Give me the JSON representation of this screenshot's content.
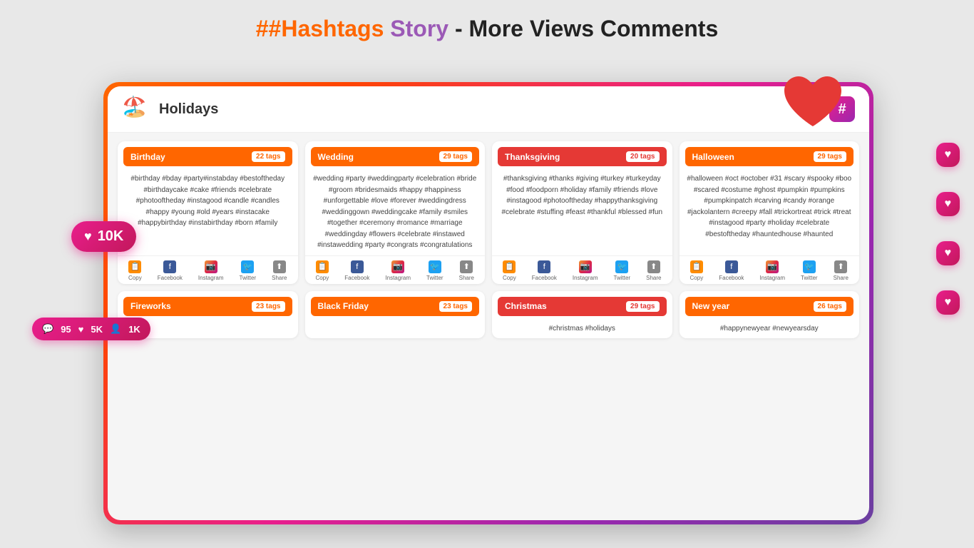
{
  "header": {
    "title_part1": "#Hashtags",
    "title_part2": " Story",
    "title_part3": " - More Views Comments"
  },
  "app": {
    "title": "Holidays",
    "logo": "🏖️",
    "hash_symbol": "#"
  },
  "cards": [
    {
      "id": "birthday",
      "title": "Birthday",
      "tags_count": "22 tags",
      "color_class": "",
      "content": "#birthday #bday #party#instabday #bestoftheday #birthdaycake #cake #friends #celebrate #photooftheday #instagood #candle #candles #happy #young #old #years #instacake #happybirthday #instabirthday #born #family",
      "has_footer": true
    },
    {
      "id": "wedding",
      "title": "Wedding",
      "tags_count": "29 tags",
      "color_class": "",
      "content": "#wedding #party #weddingparty #celebration #bride #groom #bridesmaids #happy #happiness #unforgettable #love #forever #weddingdress #weddinggown #weddingcake #family #smiles #together #ceremony #romance #marriage #weddingday #flowers #celebrate #instawed #instawedding #party #congrats #congratulations",
      "has_footer": true
    },
    {
      "id": "thanksgiving",
      "title": "Thanksgiving",
      "tags_count": "20 tags",
      "color_class": "card-thanksgiving",
      "content": "#thanksgiving #thanks #giving #turkey #turkeyday #food #foodporn #holiday #family #friends #love #instagood #photooftheday #happythanksgiving #celebrate #stuffing #feast #thankful #blessed #fun",
      "has_footer": true
    },
    {
      "id": "halloween",
      "title": "Halloween",
      "tags_count": "29 tags",
      "color_class": "card-halloween",
      "content": "#halloween #oct #october #31 #scary #spooky #boo #scared #costume #ghost #pumpkin #pumpkins #pumpkinpatch #carving #candy #orange #jackolantern #creepy #fall #trickortreat #trick #treat #instagood #party #holiday #celebrate #bestoftheday #hauntedhouse #haunted",
      "has_footer": true
    },
    {
      "id": "fireworks",
      "title": "Fireworks",
      "tags_count": "23 tags",
      "color_class": "",
      "content": "",
      "has_footer": false
    },
    {
      "id": "blackfriday",
      "title": "Black Friday",
      "tags_count": "23 tags",
      "color_class": "",
      "content": "",
      "has_footer": false
    },
    {
      "id": "christmas",
      "title": "Christmas",
      "tags_count": "29 tags",
      "color_class": "card-christmas",
      "content": "#christmas #holidays",
      "has_footer": false
    },
    {
      "id": "newyear",
      "title": "New year",
      "tags_count": "26 tags",
      "color_class": "card-newyear",
      "content": "#happynewyear #newyearsday",
      "has_footer": false
    }
  ],
  "social_buttons": [
    {
      "label": "Copy",
      "icon_class": "icon-copy",
      "symbol": "📋"
    },
    {
      "label": "Facebook",
      "icon_class": "icon-fb",
      "symbol": "f"
    },
    {
      "label": "Instagram",
      "icon_class": "icon-ig",
      "symbol": "📷"
    },
    {
      "label": "Twitter",
      "icon_class": "icon-tw",
      "symbol": "🐦"
    },
    {
      "label": "Share",
      "icon_class": "icon-share",
      "symbol": "⬆"
    }
  ],
  "badges": {
    "likes": "10K",
    "comments": "95",
    "hearts": "5K",
    "followers": "1K"
  }
}
